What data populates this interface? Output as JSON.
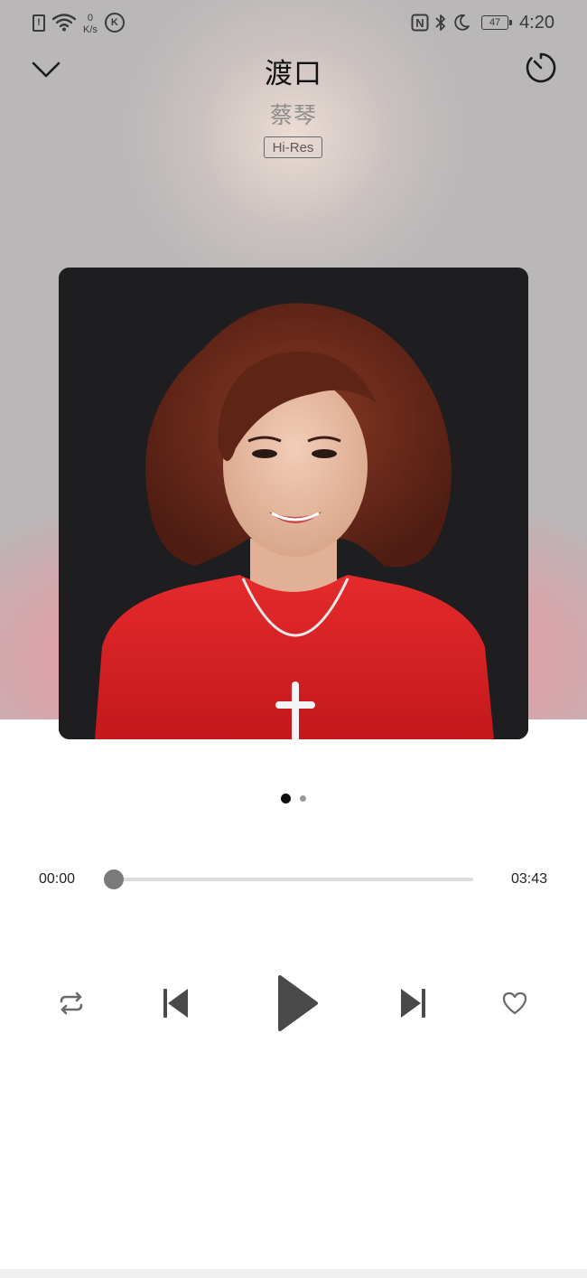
{
  "status_bar": {
    "net_speed_value": "0",
    "net_speed_unit": "K/s",
    "alert_glyph": "!",
    "k_glyph": "K",
    "nfc_glyph": "N",
    "battery_level": "47",
    "time": "4:20",
    "icons": [
      "sim-alert-icon",
      "wifi-icon",
      "k-app-icon",
      "nfc-icon",
      "bluetooth-icon",
      "moon-icon",
      "battery-icon"
    ]
  },
  "header": {
    "back_icon": "chevron-down-icon",
    "timer_icon": "sleep-timer-icon",
    "title": "渡口",
    "artist": "蔡琴",
    "quality_badge": "Hi-Res"
  },
  "album": {
    "background": "#1e1d1f",
    "accent_colors": [
      "#d8262a",
      "#6b2a1c",
      "#e8bda6"
    ]
  },
  "pager": {
    "pages": 2,
    "active_index": 0
  },
  "progress": {
    "current_time": "00:00",
    "total_time": "03:43",
    "fraction": 0.0
  },
  "controls": {
    "repeat_icon": "repeat-icon",
    "previous_icon": "skip-previous-icon",
    "play_icon": "play-icon",
    "next_icon": "skip-next-icon",
    "favorite_icon": "heart-outline-icon",
    "icon_color": "#4a4a4a"
  }
}
